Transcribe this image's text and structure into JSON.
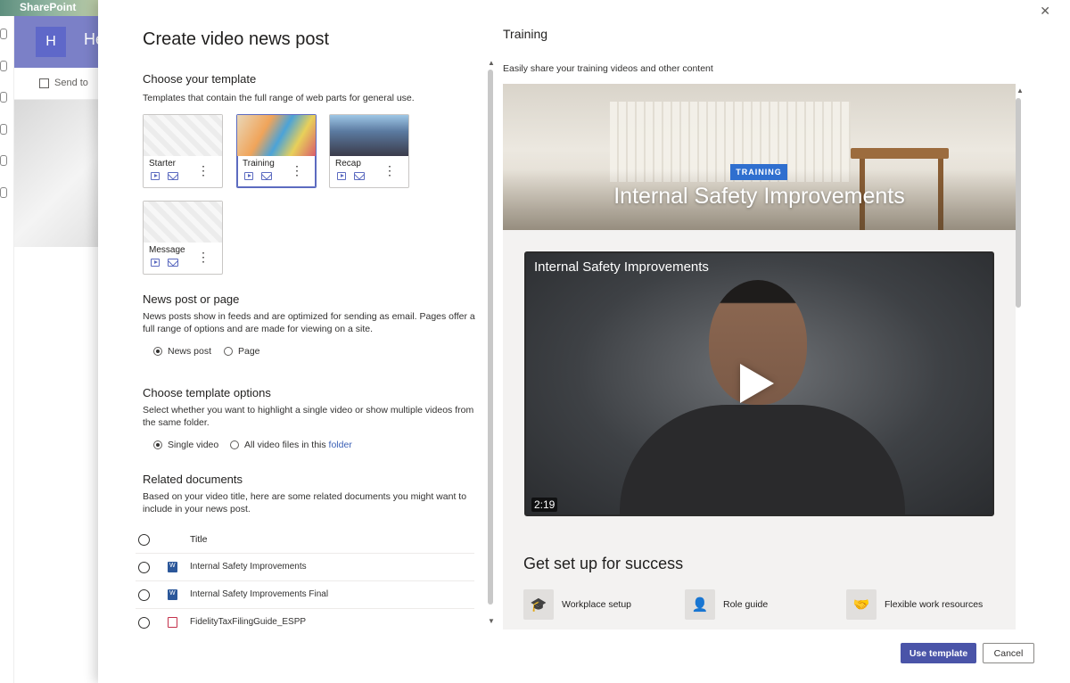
{
  "background": {
    "app_name": "SharePoint",
    "avatar_letter": "H",
    "site_name_fragment": "He",
    "command": "Send to"
  },
  "panel": {
    "title": "Create video news post",
    "close_icon": "close-icon"
  },
  "template_section": {
    "title": "Choose your template",
    "description": "Templates that contain the full range of web parts for general use.",
    "templates": [
      {
        "name": "Starter",
        "selected": false
      },
      {
        "name": "Training",
        "selected": true
      },
      {
        "name": "Recap",
        "selected": false
      },
      {
        "name": "Message",
        "selected": false
      }
    ]
  },
  "post_type": {
    "title": "News post or page",
    "description": "News posts show in feeds and are optimized for sending as email. Pages offer a full range of options and are made for viewing on a site.",
    "options": [
      "News post",
      "Page"
    ],
    "selected": "News post"
  },
  "template_options": {
    "title": "Choose template options",
    "description": "Select whether you want to highlight a single video or show multiple videos from the same folder.",
    "option_single": "Single video",
    "option_all": "All video files in this",
    "option_all_link": "folder",
    "selected": "Single video"
  },
  "related_docs": {
    "title": "Related documents",
    "description": "Based on your video title, here are some related documents you might want to include in your news post.",
    "column_title": "Title",
    "rows": [
      {
        "title": "Internal Safety Improvements",
        "icon": "word-icon"
      },
      {
        "title": "Internal Safety Improvements Final",
        "icon": "word-icon"
      },
      {
        "title": "FidelityTaxFilingGuide_ESPP",
        "icon": "pdf-icon"
      }
    ]
  },
  "preview": {
    "title": "Training",
    "description": "Easily share your training videos and other content",
    "badge": "TRAINING",
    "hero_title": "Internal Safety Improvements",
    "video_title": "Internal Safety Improvements",
    "video_duration": "2:19",
    "section_heading": "Get set up for success",
    "quick_links": [
      {
        "label": "Workplace setup",
        "icon": "graduation-cap-icon"
      },
      {
        "label": "Role guide",
        "icon": "person-icon"
      },
      {
        "label": "Flexible work resources",
        "icon": "handshake-icon"
      }
    ]
  },
  "footer": {
    "primary": "Use template",
    "secondary": "Cancel"
  },
  "colors": {
    "accent": "#4a54a8",
    "badge": "#2f6fcf",
    "link": "#3a5fb5"
  }
}
